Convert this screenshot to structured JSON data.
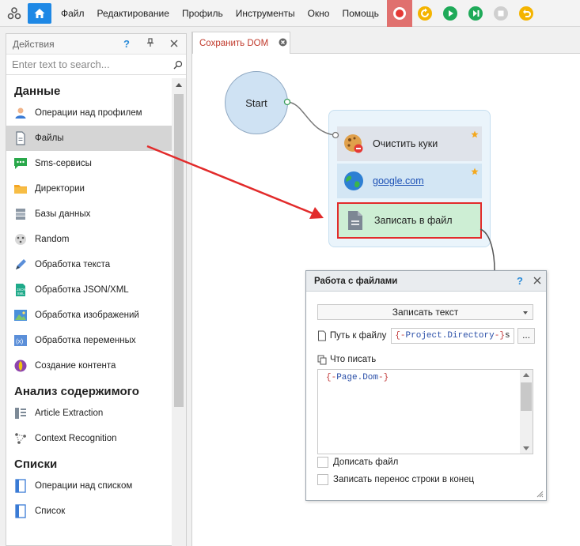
{
  "menu": [
    "Файл",
    "Редактирование",
    "Профиль",
    "Инструменты",
    "Окно",
    "Помощь"
  ],
  "toolbar_icons": [
    "record-icon",
    "restart-icon",
    "play-icon",
    "step-icon",
    "stop-icon",
    "undo-icon"
  ],
  "left_panel": {
    "title": "Действия",
    "help": "?",
    "search_placeholder": "Enter text to search...",
    "sections": [
      {
        "title": "Данные",
        "items": [
          {
            "label": "Операции над профилем",
            "icon": "user-icon"
          },
          {
            "label": "Файлы",
            "icon": "file-icon",
            "selected": true
          },
          {
            "label": "Sms-сервисы",
            "icon": "sms-icon"
          },
          {
            "label": "Директории",
            "icon": "folder-icon"
          },
          {
            "label": "Базы данных",
            "icon": "database-icon"
          },
          {
            "label": "Random",
            "icon": "dice-icon"
          },
          {
            "label": "Обработка текста",
            "icon": "pen-icon"
          },
          {
            "label": "Обработка JSON/XML",
            "icon": "json-icon"
          },
          {
            "label": "Обработка изображений",
            "icon": "image-icon"
          },
          {
            "label": "Обработка переменных",
            "icon": "variable-icon"
          },
          {
            "label": "Создание контента",
            "icon": "content-icon"
          }
        ]
      },
      {
        "title": "Анализ содержимого",
        "items": [
          {
            "label": "Article Extraction",
            "icon": "article-icon"
          },
          {
            "label": "Context Recognition",
            "icon": "context-icon"
          }
        ]
      },
      {
        "title": "Списки",
        "items": [
          {
            "label": "Операции над списком",
            "icon": "list-ops-icon"
          },
          {
            "label": "Список",
            "icon": "list-icon"
          }
        ]
      }
    ]
  },
  "editor": {
    "tab_label": "Сохранить DOM",
    "start_label": "Start",
    "nodes": [
      {
        "label": "Очистить куки",
        "icon": "cookie-icon"
      },
      {
        "label": "google.com",
        "icon": "globe-icon"
      },
      {
        "label": "Записать в файл",
        "icon": "file-write-icon"
      }
    ]
  },
  "dialog": {
    "title": "Работа с файлами",
    "help": "?",
    "mode": "Записать текст",
    "path_label": "Путь к файлу",
    "path_value": {
      "open": "{-",
      "var": "Project.Directory",
      "close": "-}",
      "tail": "s"
    },
    "dots_label": "...",
    "what_label": "Что писать",
    "text_value": {
      "open": "{-",
      "var": "Page.Dom",
      "close": "-}"
    },
    "append_label": "Дописать файл",
    "newline_label": "Записать перенос строки в конец"
  },
  "colors": {
    "accent": "#1e88e5",
    "selected_node_border": "#e22b2b",
    "arrow": "#e22b2b"
  }
}
